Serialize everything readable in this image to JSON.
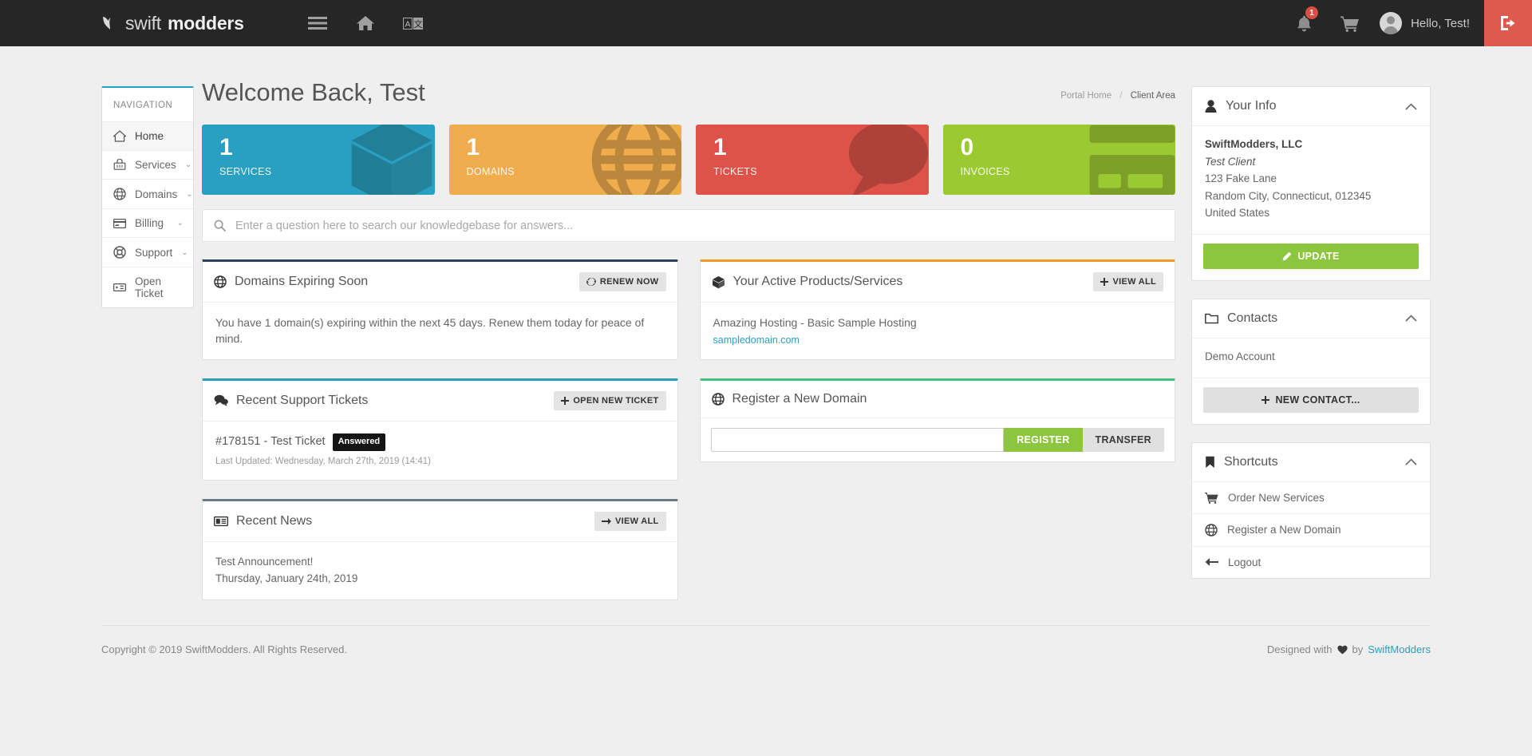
{
  "header": {
    "brand_light": "swift",
    "brand_bold": "modders",
    "logo_icon": "leaf-logo-icon",
    "menu_icon": "hamburger-menu-icon",
    "home_icon": "home-icon",
    "language_icon": "language-translate-icon",
    "notifications_icon": "bell-icon",
    "notifications_count": "1",
    "cart_icon": "shopping-cart-icon",
    "avatar_icon": "user-avatar-icon",
    "greeting": "Hello, Test!",
    "logout_icon": "logout-icon"
  },
  "sidebar": {
    "title": "NAVIGATION",
    "items": [
      {
        "label": "Home",
        "icon": "home-icon",
        "caret": "",
        "active": true
      },
      {
        "label": "Services",
        "icon": "basket-icon",
        "caret": "⌄",
        "active": false
      },
      {
        "label": "Domains",
        "icon": "globe-icon",
        "caret": "⌄",
        "active": false
      },
      {
        "label": "Billing",
        "icon": "credit-card-icon",
        "caret": "⌄",
        "active": false
      },
      {
        "label": "Support",
        "icon": "lifebuoy-icon",
        "caret": "⌄",
        "active": false
      },
      {
        "label": "Open Ticket",
        "icon": "ticket-icon",
        "caret": "",
        "active": false
      }
    ]
  },
  "main": {
    "page_title": "Welcome Back, Test",
    "breadcrumb": {
      "home": "Portal Home",
      "separator": "/",
      "current": "Client Area"
    },
    "stats": [
      {
        "number": "1",
        "label": "SERVICES",
        "color": "#29a0c1",
        "glyph": "cube-icon"
      },
      {
        "number": "1",
        "label": "DOMAINS",
        "color": "#efad4d",
        "glyph": "globe-icon"
      },
      {
        "number": "1",
        "label": "TICKETS",
        "color": "#dd5349",
        "glyph": "speech-bubble-icon"
      },
      {
        "number": "0",
        "label": "INVOICES",
        "color": "#9bc932",
        "glyph": "invoice-icon"
      }
    ],
    "search": {
      "icon": "search-icon",
      "placeholder": "Enter a question here to search our knowledgebase for answers...",
      "value": ""
    },
    "domains_expiring": {
      "icon": "globe-icon",
      "title": "Domains Expiring Soon",
      "button_label": "RENEW NOW",
      "button_icon": "refresh-icon",
      "body": "You have 1 domain(s) expiring within the next 45 days. Renew them today for peace of mind."
    },
    "recent_tickets": {
      "icon": "comments-icon",
      "title": "Recent Support Tickets",
      "button_label": "OPEN NEW TICKET",
      "button_icon": "plus-icon",
      "items": [
        {
          "title": "#178151 - Test Ticket",
          "status": "Answered",
          "meta": "Last Updated: Wednesday, March 27th, 2019 (14:41)"
        }
      ]
    },
    "recent_news": {
      "icon": "newspaper-icon",
      "title": "Recent News",
      "button_label": "VIEW ALL",
      "button_icon": "arrow-right-icon",
      "items": [
        {
          "headline": "Test Announcement!",
          "date": "Thursday, January 24th, 2019"
        }
      ]
    },
    "active_products": {
      "icon": "cube-icon",
      "title": "Your Active Products/Services",
      "button_label": "VIEW ALL",
      "button_icon": "plus-icon",
      "items": [
        {
          "name": "Amazing Hosting - Basic Sample Hosting",
          "domain": "sampledomain.com"
        }
      ]
    },
    "register_domain": {
      "icon": "globe-icon",
      "title": "Register a New Domain",
      "input_value": "",
      "input_placeholder": "",
      "register_label": "REGISTER",
      "transfer_label": "TRANSFER"
    }
  },
  "rightbar": {
    "your_info": {
      "icon": "user-icon",
      "title": "Your Info",
      "chevron": "chevron-up-icon",
      "company": "SwiftModders, LLC",
      "client": "Test Client",
      "address1": "123 Fake Lane",
      "address2": "Random City, Connecticut, 012345",
      "country": "United States",
      "button_label": "UPDATE",
      "button_icon": "pencil-icon"
    },
    "contacts": {
      "icon": "folder-icon",
      "title": "Contacts",
      "chevron": "chevron-up-icon",
      "items": [
        "Demo Account"
      ],
      "button_label": "NEW CONTACT...",
      "button_icon": "plus-icon"
    },
    "shortcuts": {
      "icon": "bookmark-icon",
      "title": "Shortcuts",
      "chevron": "chevron-up-icon",
      "items": [
        {
          "label": "Order New Services",
          "icon": "shopping-cart-icon"
        },
        {
          "label": "Register a New Domain",
          "icon": "globe-icon"
        },
        {
          "label": "Logout",
          "icon": "arrow-left-icon"
        }
      ]
    }
  },
  "footer": {
    "copyright": "Copyright © 2019 SwiftModders. All Rights Reserved.",
    "designed_prefix": "Designed with",
    "heart_icon": "heart-icon",
    "designed_by": "by",
    "designed_link": "SwiftModders"
  },
  "colors": {
    "accent_blue": "#29a0c1",
    "accent_green": "#8cc63e",
    "accent_orange": "#efad4d",
    "accent_red": "#dd5349",
    "navbar": "#262626",
    "logout_red": "#dc5b4e"
  }
}
